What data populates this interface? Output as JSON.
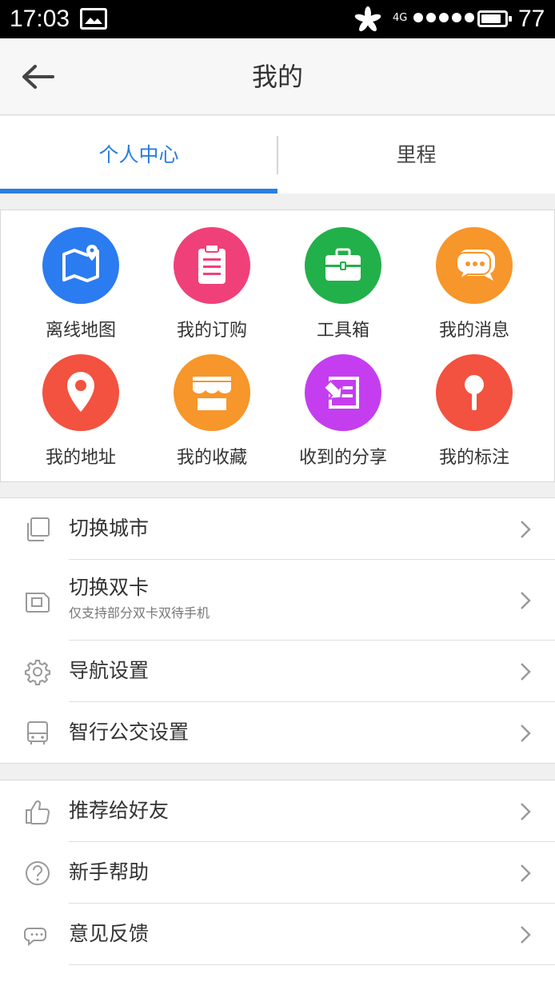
{
  "status_bar": {
    "time": "17:03",
    "network": "4G",
    "battery": "77",
    "icons": [
      "image-icon",
      "flower-icon",
      "signal-dots-icon",
      "battery-icon"
    ]
  },
  "header": {
    "title": "我的",
    "back_icon": "back-arrow-icon"
  },
  "tabs": [
    {
      "label": "个人中心",
      "active": true
    },
    {
      "label": "里程",
      "active": false
    }
  ],
  "grid": [
    {
      "label": "离线地图",
      "icon": "offline-map-icon",
      "color": "#2b7cf0"
    },
    {
      "label": "我的订购",
      "icon": "clipboard-icon",
      "color": "#f0407a"
    },
    {
      "label": "工具箱",
      "icon": "toolbox-icon",
      "color": "#22b04a"
    },
    {
      "label": "我的消息",
      "icon": "chat-bubbles-icon",
      "color": "#f7962a"
    },
    {
      "label": "我的地址",
      "icon": "location-pin-icon",
      "color": "#f2523f"
    },
    {
      "label": "我的收藏",
      "icon": "store-icon",
      "color": "#f7962a"
    },
    {
      "label": "收到的分享",
      "icon": "share-received-icon",
      "color": "#c43ef0"
    },
    {
      "label": "我的标注",
      "icon": "marker-pin-icon",
      "color": "#f2523f"
    }
  ],
  "settings": [
    {
      "label": "切换城市",
      "icon": "switch-city-icon"
    },
    {
      "label": "切换双卡",
      "sublabel": "仅支持部分双卡双待手机",
      "icon": "sim-card-icon"
    },
    {
      "label": "导航设置",
      "icon": "gear-icon"
    },
    {
      "label": "智行公交设置",
      "icon": "bus-icon"
    }
  ],
  "misc": [
    {
      "label": "推荐给好友",
      "icon": "thumbs-up-icon"
    },
    {
      "label": "新手帮助",
      "icon": "help-icon"
    },
    {
      "label": "意见反馈",
      "icon": "feedback-icon"
    }
  ]
}
